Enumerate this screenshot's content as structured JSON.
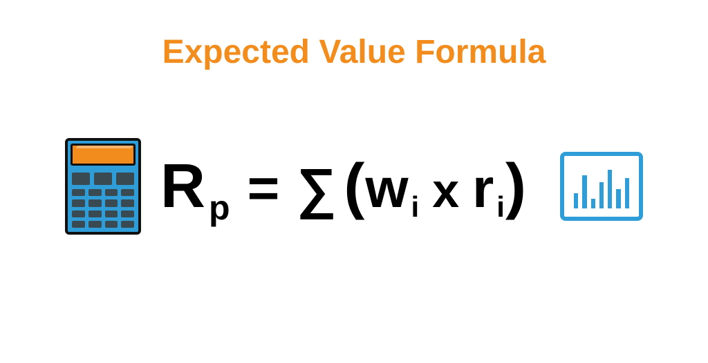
{
  "title": "Expected Value Formula",
  "formula": {
    "lhs_var": "R",
    "lhs_sub": "p",
    "eq": "=",
    "sigma": "∑",
    "lparen": "(",
    "w": "w",
    "w_sub": "i",
    "mult": "x",
    "r": "r",
    "r_sub": "i",
    "rparen": ")"
  },
  "colors": {
    "accent_orange": "#f28c1c",
    "accent_blue": "#2f9ed8"
  },
  "chart_bars": [
    22,
    48,
    14,
    38,
    56,
    28,
    44
  ]
}
